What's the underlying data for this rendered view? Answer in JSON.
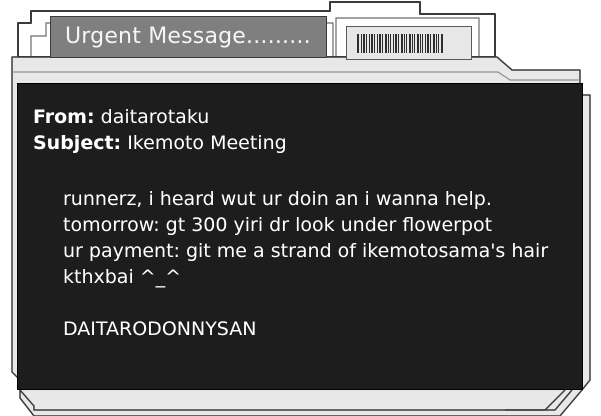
{
  "window": {
    "title": "Urgent Message........."
  },
  "message": {
    "from_label": "From:",
    "from_value": "daitarotaku",
    "subject_label": "Subject:",
    "subject_value": "Ikemoto Meeting",
    "body_lines": [
      "runnerz, i heard wut ur doin an i wanna help.",
      "tomorrow: gt 300 yiri dr look under flowerpot",
      "ur payment: git me a strand of ikemotosama's hair",
      "kthxbai ^_^",
      "",
      "DAITARODONNYSAN"
    ]
  },
  "icons": {
    "barcode": "barcode-icon"
  },
  "colors": {
    "panel_bg": "#1d1d1d",
    "panel_text": "#ffffff",
    "title_tab_bg": "#7f7f7f",
    "frame_bg": "#e8e8e8",
    "frame_stroke": "#3a3a3a"
  }
}
